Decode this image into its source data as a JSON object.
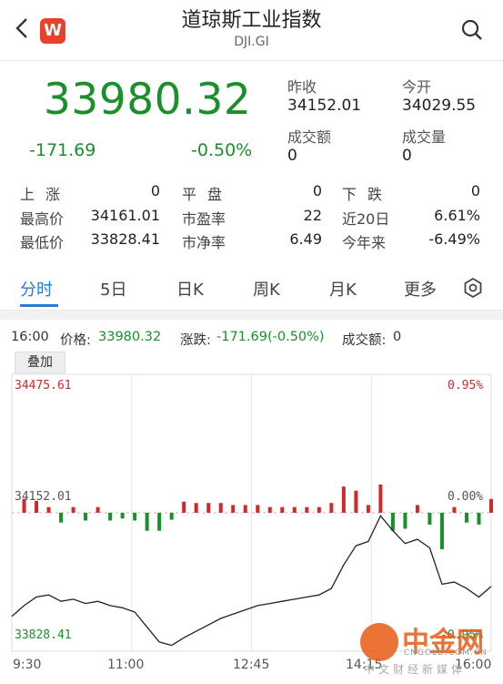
{
  "header": {
    "back_icon": "chevron-left-icon",
    "logo_text": "W",
    "title": "道琼斯工业指数",
    "code": "DJI.GI",
    "search_icon": "search-icon"
  },
  "quote": {
    "price": "33980.32",
    "change": "-171.69",
    "change_pct": "-0.50%",
    "prev_close_label": "昨收",
    "prev_close": "34152.01",
    "open_label": "今开",
    "open": "34029.55",
    "turnover_label": "成交额",
    "turnover": "0",
    "volume_label": "成交量",
    "volume": "0"
  },
  "stats": {
    "up_label": "上涨",
    "up": "0",
    "flat_label": "平盘",
    "flat": "0",
    "down_label": "下跌",
    "down": "0",
    "high_label": "最高价",
    "high": "34161.01",
    "pe_label": "市盈率",
    "pe": "22",
    "d20_label": "近20日",
    "d20": "6.61%",
    "low_label": "最低价",
    "low": "33828.41",
    "pb_label": "市净率",
    "pb": "6.49",
    "ytd_label": "今年来",
    "ytd": "-6.49%"
  },
  "tabs": [
    "分时",
    "5日",
    "日K",
    "周K",
    "月K",
    "更多"
  ],
  "active_tab": "分时",
  "settings_icon": "settings-icon",
  "chart_info": {
    "time": "16:00",
    "price_label": "价格:",
    "price": "33980.32",
    "change_label": "涨跌:",
    "change": "-171.69(-0.50%)",
    "turnover_label": "成交额:",
    "turnover": "0"
  },
  "overlay_label": "叠加",
  "chart_data": {
    "type": "line",
    "title": "",
    "xlabel": "",
    "ylabel": "",
    "ylim": [
      33828.41,
      34475.61
    ],
    "y_ticks": [
      "34475.61",
      "34152.01",
      "33828.41"
    ],
    "y_right_ticks": [
      "0.95%",
      "0.00%",
      "-0.95%"
    ],
    "x_ticks": [
      "9:30",
      "11:00",
      "12:45",
      "14:15",
      "16:00"
    ],
    "baseline": 34152.01,
    "colors": {
      "line": "#222222",
      "up": "#d2282c",
      "down": "#1a8f2a"
    },
    "series": [
      {
        "x": [
          "9:30",
          "9:40",
          "9:50",
          "10:00",
          "10:10",
          "10:20",
          "10:30",
          "10:40",
          "10:50",
          "11:00",
          "11:10",
          "11:20",
          "11:30",
          "11:40",
          "11:50",
          "12:00",
          "12:10",
          "12:20",
          "12:30",
          "12:40",
          "12:50",
          "13:00",
          "13:10",
          "13:20",
          "13:30",
          "13:40",
          "13:50",
          "14:00",
          "14:10",
          "14:20",
          "14:30",
          "14:40",
          "14:50",
          "15:00",
          "15:10",
          "15:20",
          "15:30",
          "15:40",
          "15:50",
          "16:00"
        ],
        "values": [
          33910,
          33935,
          33955,
          33960,
          33945,
          33950,
          33940,
          33945,
          33935,
          33930,
          33920,
          33885,
          33850,
          33842,
          33860,
          33875,
          33890,
          33905,
          33915,
          33925,
          33935,
          33940,
          33945,
          33950,
          33955,
          33960,
          33975,
          34030,
          34075,
          34085,
          34145,
          34110,
          34080,
          34090,
          34070,
          33985,
          33990,
          33975,
          33955,
          33980
        ]
      }
    ]
  },
  "watermark": {
    "brand": "中金网",
    "domain": "CNGOLD.COM.CN",
    "slogan": "中文财经新媒体"
  }
}
